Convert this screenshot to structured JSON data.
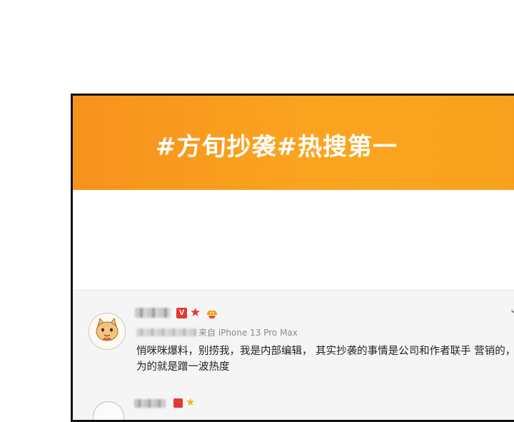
{
  "banner": {
    "title": "#方旬抄袭#热搜第一"
  },
  "post": {
    "badges": {
      "verified": "V",
      "star": "★"
    },
    "source": "来自 iPhone 13 Pro Max",
    "text": "悄咪咪爆料，别捞我，我是内部编辑， 其实抄袭的事情是公司和作者联手 营销的，为的就是蹭一波热度",
    "icons": {
      "avatar": "fox-avatar-icon",
      "menu": "chevron-down-icon",
      "fans": "fans-badge-icon"
    }
  },
  "colors": {
    "banner_start": "#f7921d",
    "banner_end": "#fba51f",
    "badge_red": "#e03a2f",
    "meta_gray": "#8a8a8a",
    "text_dark": "#222222",
    "feed_bg": "#f5f5f5"
  }
}
